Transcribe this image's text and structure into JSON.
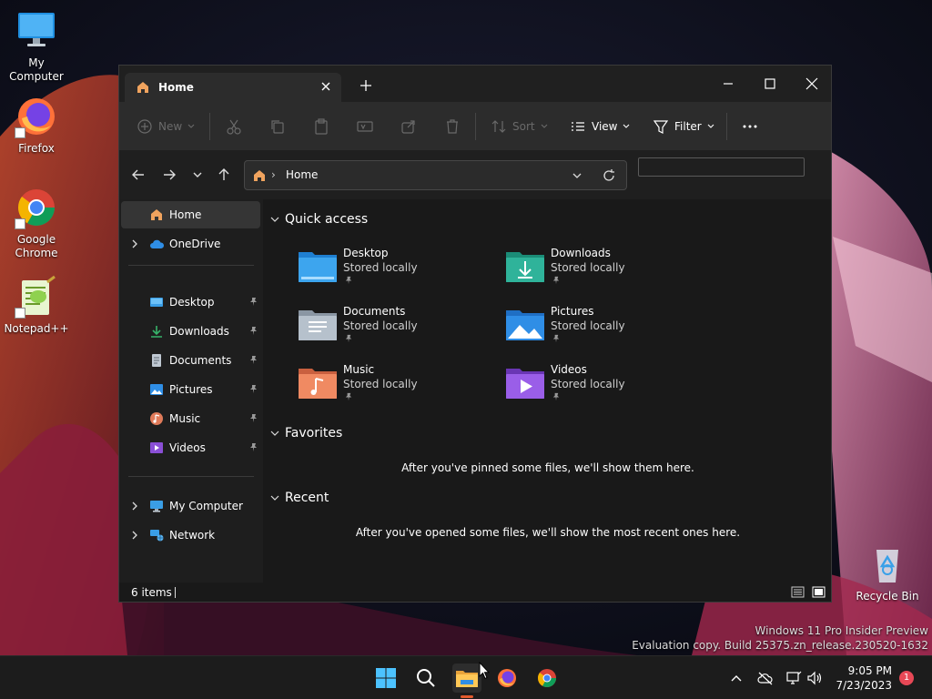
{
  "desktop": {
    "icons": [
      {
        "label": "My Computer"
      },
      {
        "label": "Firefox"
      },
      {
        "label": "Google Chrome"
      },
      {
        "label": "Notepad++"
      },
      {
        "label": "Recycle Bin"
      }
    ],
    "watermark": {
      "line1": "Windows 11 Pro Insider Preview",
      "line2": "Evaluation copy. Build 25375.zn_release.230520-1632"
    }
  },
  "window": {
    "tab": {
      "title": "Home"
    },
    "commands": {
      "new": "New",
      "sort": "Sort",
      "view": "View",
      "filter": "Filter"
    },
    "address": {
      "path": "Home"
    },
    "search": {
      "value": ""
    }
  },
  "sidebar": {
    "top": [
      {
        "label": "Home"
      },
      {
        "label": "OneDrive"
      }
    ],
    "pinned": [
      {
        "label": "Desktop"
      },
      {
        "label": "Downloads"
      },
      {
        "label": "Documents"
      },
      {
        "label": "Pictures"
      },
      {
        "label": "Music"
      },
      {
        "label": "Videos"
      }
    ],
    "bottom": [
      {
        "label": "My Computer"
      },
      {
        "label": "Network"
      }
    ]
  },
  "content": {
    "quick_access": {
      "title": "Quick access",
      "items": [
        {
          "name": "Desktop",
          "sub": "Stored locally"
        },
        {
          "name": "Downloads",
          "sub": "Stored locally"
        },
        {
          "name": "Documents",
          "sub": "Stored locally"
        },
        {
          "name": "Pictures",
          "sub": "Stored locally"
        },
        {
          "name": "Music",
          "sub": "Stored locally"
        },
        {
          "name": "Videos",
          "sub": "Stored locally"
        }
      ]
    },
    "favorites": {
      "title": "Favorites",
      "empty": "After you've pinned some files, we'll show them here."
    },
    "recent": {
      "title": "Recent",
      "empty": "After you've opened some files, we'll show the most recent ones here."
    }
  },
  "statusbar": {
    "items": "6 items"
  },
  "taskbar": {
    "time": "9:05 PM",
    "date": "7/23/2023",
    "notifications": "1"
  },
  "colors": {
    "accent": "#e25a2d",
    "folder_blue": "#3a9ee6",
    "folder_green": "#2fb39a",
    "badge": "#e74856"
  }
}
